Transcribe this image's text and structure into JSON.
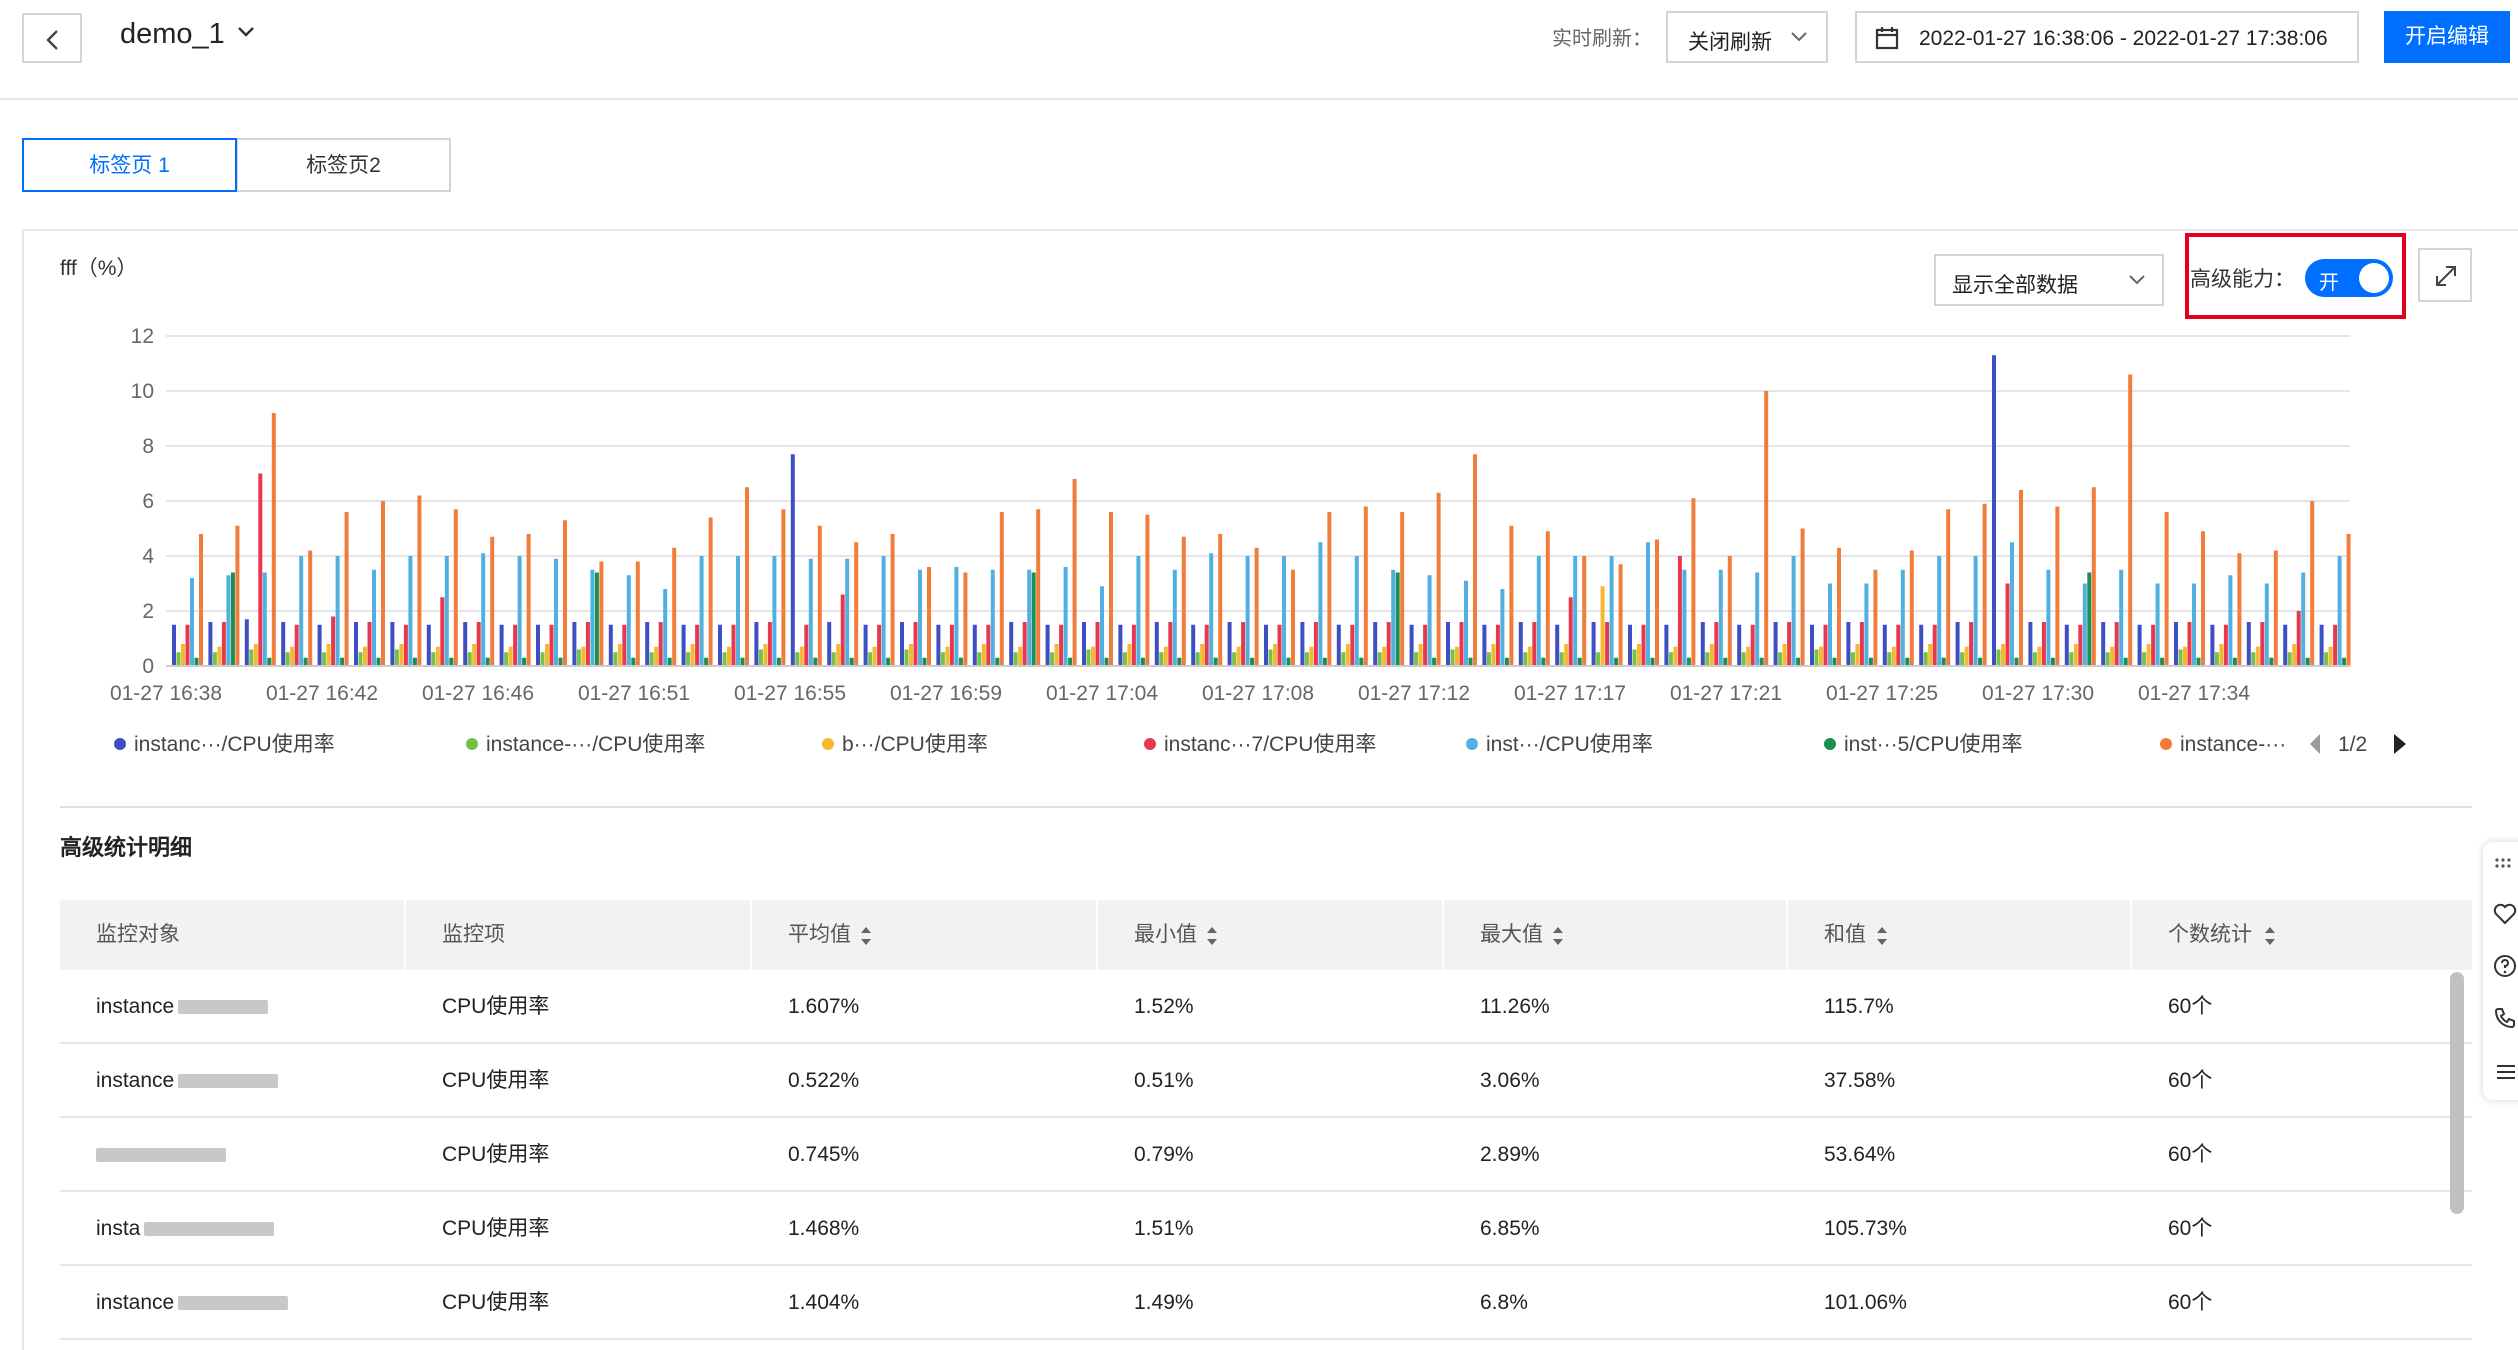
{
  "header": {
    "dashboard_name": "demo_1",
    "refresh_label": "实时刷新：",
    "refresh_value": "关闭刷新",
    "time_range": "2022-01-27 16:38:06 - 2022-01-27 17:38:06",
    "edit_button": "开启编辑"
  },
  "tabs": [
    {
      "label": "标签页 1",
      "active": true
    },
    {
      "label": "标签页2",
      "active": false
    }
  ],
  "panel": {
    "title": "fff（%）",
    "data_filter": "显示全部数据",
    "advanced_label": "高级能力：",
    "advanced_switch": "开",
    "highlight_color": "#e3001b"
  },
  "chart_data": {
    "type": "bar",
    "ylim": [
      0,
      12
    ],
    "yticks": [
      "0",
      "2",
      "4",
      "6",
      "8",
      "10",
      "12"
    ],
    "xtick_labels": [
      "01-27 16:38",
      "01-27 16:42",
      "01-27 16:46",
      "01-27 16:51",
      "01-27 16:55",
      "01-27 16:59",
      "01-27 17:04",
      "01-27 17:08",
      "01-27 17:12",
      "01-27 17:17",
      "01-27 17:21",
      "01-27 17:25",
      "01-27 17:30",
      "01-27 17:34"
    ],
    "categories_count": 60,
    "series": [
      {
        "name": "instanc···/CPU使用率",
        "color": "#3d4fc2",
        "values": [
          1.5,
          1.6,
          1.7,
          1.6,
          1.5,
          1.6,
          1.6,
          1.5,
          1.6,
          1.5,
          1.5,
          1.6,
          1.5,
          1.6,
          1.5,
          1.5,
          1.6,
          7.7,
          1.6,
          1.5,
          1.6,
          1.5,
          1.5,
          1.6,
          1.5,
          1.6,
          1.5,
          1.6,
          1.5,
          1.6,
          1.5,
          1.6,
          1.5,
          1.6,
          1.5,
          1.6,
          1.5,
          1.6,
          1.5,
          1.6,
          1.5,
          1.5,
          1.6,
          1.5,
          1.6,
          1.5,
          1.6,
          1.5,
          1.5,
          1.6,
          11.3,
          1.6,
          1.5,
          1.6,
          1.5,
          1.6,
          1.5,
          1.6,
          1.5,
          1.5
        ]
      },
      {
        "name": "instance-···/CPU使用率",
        "color": "#74c24a",
        "values": [
          0.5,
          0.5,
          0.6,
          0.5,
          0.5,
          0.5,
          0.6,
          0.5,
          0.5,
          0.5,
          0.5,
          0.6,
          0.5,
          0.5,
          0.5,
          0.5,
          0.6,
          0.5,
          0.5,
          0.5,
          0.6,
          0.5,
          0.5,
          0.5,
          0.5,
          0.6,
          0.5,
          0.5,
          0.5,
          0.5,
          0.6,
          0.5,
          0.5,
          0.5,
          0.5,
          0.6,
          0.5,
          0.5,
          0.5,
          0.5,
          0.6,
          0.5,
          0.5,
          0.5,
          0.5,
          0.6,
          0.5,
          0.5,
          0.5,
          0.5,
          0.6,
          0.5,
          0.5,
          0.5,
          0.5,
          0.6,
          0.5,
          0.5,
          0.5,
          0.5
        ]
      },
      {
        "name": "b···/CPU使用率",
        "color": "#f5b82e",
        "values": [
          0.8,
          0.7,
          0.8,
          0.7,
          0.8,
          0.7,
          0.8,
          0.7,
          0.8,
          0.7,
          0.8,
          0.7,
          0.8,
          0.7,
          0.8,
          0.7,
          0.8,
          0.7,
          0.8,
          0.7,
          0.8,
          0.7,
          0.8,
          0.7,
          0.8,
          0.7,
          0.8,
          0.7,
          0.8,
          0.7,
          0.8,
          0.7,
          0.8,
          0.7,
          0.8,
          0.7,
          0.8,
          0.7,
          0.8,
          2.9,
          0.8,
          0.7,
          0.8,
          0.7,
          0.8,
          0.7,
          0.8,
          0.7,
          0.8,
          0.7,
          0.8,
          0.7,
          0.8,
          0.7,
          0.8,
          0.7,
          0.8,
          0.7,
          0.8,
          0.7
        ]
      },
      {
        "name": "instanc···7/CPU使用率",
        "color": "#e9384d",
        "values": [
          1.5,
          1.6,
          7.0,
          1.5,
          1.8,
          1.6,
          1.5,
          2.5,
          1.6,
          1.5,
          1.5,
          1.6,
          1.5,
          1.6,
          1.5,
          1.5,
          1.6,
          1.5,
          2.6,
          1.5,
          1.6,
          1.5,
          1.5,
          1.6,
          1.5,
          1.6,
          1.5,
          1.6,
          1.5,
          1.6,
          1.5,
          1.6,
          1.5,
          1.6,
          1.5,
          1.6,
          1.5,
          1.6,
          2.5,
          1.6,
          1.5,
          4.0,
          1.6,
          1.5,
          1.6,
          1.5,
          1.6,
          1.5,
          1.5,
          1.6,
          3.0,
          1.6,
          1.5,
          1.6,
          1.5,
          1.6,
          1.5,
          1.6,
          2.0,
          1.5
        ]
      },
      {
        "name": "inst···/CPU使用率",
        "color": "#52b0e0",
        "values": [
          3.2,
          3.3,
          3.4,
          4.0,
          4.0,
          3.5,
          4.0,
          4.0,
          4.1,
          4.0,
          3.9,
          3.5,
          3.3,
          2.8,
          4.0,
          4.0,
          4.0,
          3.9,
          3.9,
          4.0,
          3.5,
          3.6,
          3.5,
          3.5,
          3.6,
          2.9,
          4.0,
          3.5,
          4.1,
          4.0,
          4.0,
          4.5,
          4.0,
          3.5,
          3.3,
          3.1,
          2.8,
          4.0,
          4.0,
          4.0,
          4.5,
          3.5,
          3.5,
          3.4,
          4.0,
          3.0,
          3.0,
          3.5,
          4.0,
          4.0,
          4.5,
          3.5,
          3.0,
          3.5,
          3.0,
          3.0,
          3.3,
          3.0,
          3.4,
          4.0
        ]
      },
      {
        "name": "inst···5/CPU使用率",
        "color": "#1f8f4e",
        "values": [
          0.3,
          3.4,
          0.3,
          0.3,
          0.3,
          0.3,
          0.3,
          0.3,
          0.3,
          0.3,
          0.3,
          3.4,
          0.3,
          0.3,
          0.3,
          0.3,
          0.3,
          0.3,
          0.3,
          0.3,
          0.3,
          0.3,
          0.3,
          3.4,
          0.3,
          0.3,
          0.3,
          0.3,
          0.3,
          0.3,
          0.3,
          0.3,
          0.3,
          3.4,
          0.3,
          0.3,
          0.3,
          0.3,
          0.3,
          0.3,
          0.3,
          0.3,
          0.3,
          0.3,
          0.3,
          0.3,
          0.3,
          0.3,
          0.3,
          0.3,
          0.3,
          0.3,
          3.4,
          0.3,
          0.3,
          0.3,
          0.3,
          0.3,
          0.3,
          0.3
        ]
      },
      {
        "name": "instance-···",
        "color": "#f07d3c",
        "values": [
          4.8,
          5.1,
          9.2,
          4.2,
          5.6,
          6.0,
          6.2,
          5.7,
          4.7,
          4.8,
          5.3,
          3.8,
          3.8,
          4.3,
          5.4,
          6.5,
          5.7,
          5.1,
          4.5,
          4.8,
          3.6,
          3.4,
          5.6,
          5.7,
          6.8,
          5.6,
          5.5,
          4.7,
          4.8,
          4.3,
          3.5,
          5.6,
          5.8,
          5.6,
          6.3,
          7.7,
          5.1,
          4.9,
          4.0,
          3.7,
          4.6,
          6.1,
          4.0,
          10.0,
          5.0,
          4.3,
          3.5,
          4.2,
          5.7,
          5.9,
          6.4,
          5.8,
          6.5,
          10.6,
          5.6,
          4.9,
          4.1,
          4.2,
          6.0,
          4.8
        ]
      }
    ],
    "legend_position": "bottom",
    "legend_page": "1/2",
    "grid": true
  },
  "stats": {
    "title": "高级统计明细",
    "columns": [
      "监控对象",
      "监控项",
      "平均值",
      "最小值",
      "最大值",
      "和值",
      "个数统计"
    ],
    "rows": [
      {
        "object": "instance",
        "metric": "CPU使用率",
        "avg": "1.607%",
        "min": "1.52%",
        "max": "11.26%",
        "sum": "115.7%",
        "count": "60个"
      },
      {
        "object": "instance",
        "metric": "CPU使用率",
        "avg": "0.522%",
        "min": "0.51%",
        "max": "3.06%",
        "sum": "37.58%",
        "count": "60个"
      },
      {
        "object": "",
        "metric": "CPU使用率",
        "avg": "0.745%",
        "min": "0.79%",
        "max": "2.89%",
        "sum": "53.64%",
        "count": "60个"
      },
      {
        "object": "insta",
        "metric": "CPU使用率",
        "avg": "1.468%",
        "min": "1.51%",
        "max": "6.85%",
        "sum": "105.73%",
        "count": "60个"
      },
      {
        "object": "instance",
        "metric": "CPU使用率",
        "avg": "1.404%",
        "min": "1.49%",
        "max": "6.8%",
        "sum": "101.06%",
        "count": "60个"
      }
    ]
  }
}
